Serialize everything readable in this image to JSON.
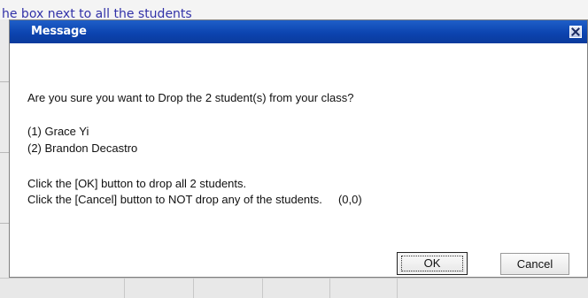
{
  "background": {
    "instruction_text": "he box next to all the students"
  },
  "dialog": {
    "title": "Message",
    "close_icon": "close-icon",
    "lines": {
      "question": "Are you sure you want to Drop the 2 student(s) from your class?",
      "student_1": "(1) Grace Yi",
      "student_2": "(2) Brandon Decastro",
      "ok_hint": "Click the [OK] button to drop all 2 students.",
      "cancel_hint": "Click the [Cancel] button to NOT drop any of the students.     (0,0)"
    },
    "buttons": {
      "ok_label": "OK",
      "cancel_label": "Cancel"
    }
  },
  "colors": {
    "titlebar": "#0c44b0",
    "background_link_text": "#3232a8"
  }
}
